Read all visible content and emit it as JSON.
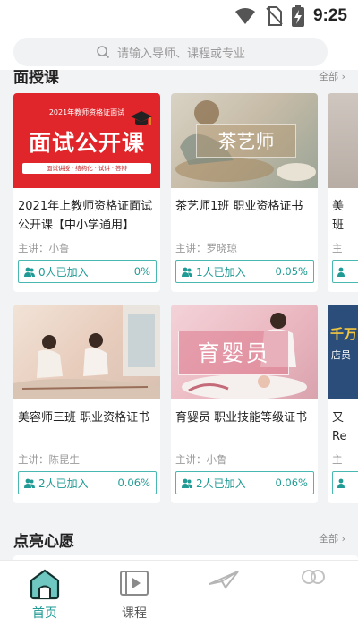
{
  "status_bar": {
    "time": "9:25",
    "icons": [
      "wifi-icon",
      "no-sim-icon",
      "battery-charging-icon"
    ]
  },
  "search": {
    "placeholder": "请输入导师、课程或专业"
  },
  "section_live": {
    "title": "面授课",
    "more": "全部 ›"
  },
  "courses": [
    {
      "thumb_title": "面试公开课",
      "thumb_top": "2021年教师资格证面试",
      "thumb_sub": "面试讲授 · 结构化 · 试讲 · 答辩",
      "title": "2021年上教师资格证面试公开课【中小学通用】",
      "teacher": "主讲：小鲁",
      "joined": "0人已加入",
      "pct": "0%"
    },
    {
      "thumb_title": "茶艺师",
      "title": "茶艺师1班 职业资格证书",
      "teacher": "主讲：罗晓琼",
      "joined": "1人已加入",
      "pct": "0.05%"
    },
    {
      "title": "美容师三班 职业资格证书",
      "teacher": "主讲：陈昆生",
      "joined": "2人已加入",
      "pct": "0.06%"
    },
    {
      "thumb_title": "育婴员",
      "title": "育婴员 职业技能等级证书",
      "teacher": "主讲：小鲁",
      "joined": "2人已加入",
      "pct": "0.06%"
    }
  ],
  "peek_cards": [
    {
      "title_1": "美",
      "title_2": "班",
      "teacher": "主"
    },
    {
      "thumb_title": "千万",
      "thumb_sub": "店员",
      "title_1": "又",
      "title_2": "Re",
      "teacher": "主"
    }
  ],
  "section_wish": {
    "title": "点亮心愿",
    "more": "全部 ›"
  },
  "nav": [
    {
      "label": "首页",
      "icon": "home-icon",
      "active": true
    },
    {
      "label": "课程",
      "icon": "video-course-icon",
      "active": false
    },
    {
      "label": "",
      "icon": "paper-plane-icon",
      "active": false
    },
    {
      "label": "",
      "icon": "people-icon",
      "active": false
    }
  ],
  "colors": {
    "accent": "#1f9a94",
    "red_banner": "#e0262a",
    "nav_active": "#1f9a94"
  }
}
